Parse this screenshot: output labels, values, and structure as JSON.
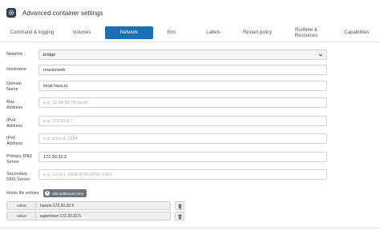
{
  "header": {
    "title": "Advanced container settings",
    "icon": "gear-icon"
  },
  "tabs": [
    {
      "label": "Command & logging",
      "active": false
    },
    {
      "label": "Volumes",
      "active": false
    },
    {
      "label": "Network",
      "active": true
    },
    {
      "label": "Env",
      "active": false
    },
    {
      "label": "Labels",
      "active": false
    },
    {
      "label": "Restart policy",
      "active": false
    },
    {
      "label": "Runtime & Resources",
      "active": false
    },
    {
      "label": "Capabilities",
      "active": false
    }
  ],
  "form": {
    "network": {
      "label": "Network",
      "value": "bridge"
    },
    "hostname": {
      "label": "Hostname",
      "value": "reactorweb"
    },
    "domain_name": {
      "label": "Domain Name",
      "value": "local.hass.io"
    },
    "mac_address": {
      "label": "Mac Address",
      "value": "",
      "placeholder": "e.g. 12-34-56-78-9a-bc"
    },
    "ipv4_address": {
      "label": "IPv4 Address",
      "value": "",
      "placeholder": "e.g. 172.20.0.7"
    },
    "ipv6_address": {
      "label": "IPv6 Address",
      "value": "",
      "placeholder": "e.g. a:b:c:d::1234"
    },
    "primary_dns": {
      "label": "Primary DNS Server",
      "value": "172.30.32.3"
    },
    "secondary_dns": {
      "label": "Secondary DNS Server",
      "value": "",
      "placeholder": "e.g. 1.0.0.1, 2606:4700:4700::1001"
    }
  },
  "hosts": {
    "label": "Hosts file entries",
    "add_label": "add additional entry",
    "entries": [
      {
        "addon": "value",
        "value": "hassio:172.30.32.5"
      },
      {
        "addon": "value",
        "value": "supervisor:172.30.32.5"
      }
    ]
  }
}
